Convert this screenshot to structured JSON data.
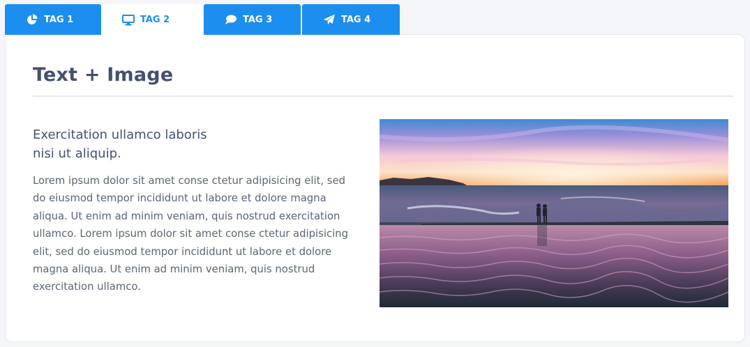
{
  "tabs": [
    {
      "label": "TAG 1",
      "icon": "pie-chart-icon",
      "active": false
    },
    {
      "label": "TAG 2",
      "icon": "monitor-icon",
      "active": true
    },
    {
      "label": "TAG 3",
      "icon": "speech-bubble-icon",
      "active": false
    },
    {
      "label": "TAG 4",
      "icon": "paper-plane-icon",
      "active": false
    }
  ],
  "content": {
    "title": "Text + Image",
    "subtitle": "Exercitation ullamco laboris\nnisi ut aliquip.",
    "body": "Lorem ipsum dolor sit amet conse ctetur adipisicing elit, sed do eiusmod tempor incididunt ut labore et dolore magna aliqua. Ut enim ad minim veniam, quis nostrud exercitation ullamco. Lorem ipsum dolor sit amet conse ctetur adipisicing elit, sed do eiusmod tempor incididunt ut labore et dolore magna aliqua. Ut enim ad minim veniam, quis nostrud exercitation ullamco.",
    "image_description": "sunset-beach-photo"
  },
  "colors": {
    "accent": "#1b8ef0",
    "heading": "#44506f",
    "text": "#5b6478",
    "background": "#f5f6fa"
  }
}
